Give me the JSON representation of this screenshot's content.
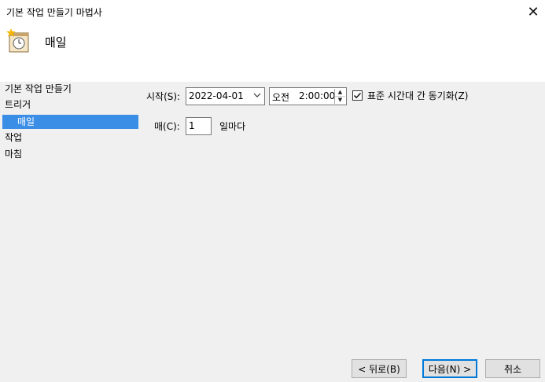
{
  "window": {
    "title": "기본 작업 만들기 마법사",
    "close_glyph": "✕"
  },
  "header": {
    "title": "매일",
    "icon": "calendar-clock-icon"
  },
  "nav": {
    "items": [
      {
        "label": "기본 작업 만들기",
        "selected": false
      },
      {
        "label": "트리거",
        "selected": false
      },
      {
        "label": "매일",
        "selected": true
      },
      {
        "label": "작업",
        "selected": false
      },
      {
        "label": "마침",
        "selected": false
      }
    ]
  },
  "form": {
    "start_label": "시작(S):",
    "start_date": "2022-04-01",
    "ampm": "오전",
    "start_time": "2:00:00",
    "sync_timezones_label": "표준 시간대 간 동기화(Z)",
    "sync_timezones_checked": true,
    "recur_label": "매(C):",
    "recur_value": "1",
    "recur_unit": "일마다"
  },
  "buttons": {
    "back": "< 뒤로(B)",
    "next": "다음(N) >",
    "cancel": "취소"
  },
  "colors": {
    "accent": "#3a8ee6",
    "panel_bg": "#f0f0f0",
    "primary_border": "#0078d7"
  }
}
